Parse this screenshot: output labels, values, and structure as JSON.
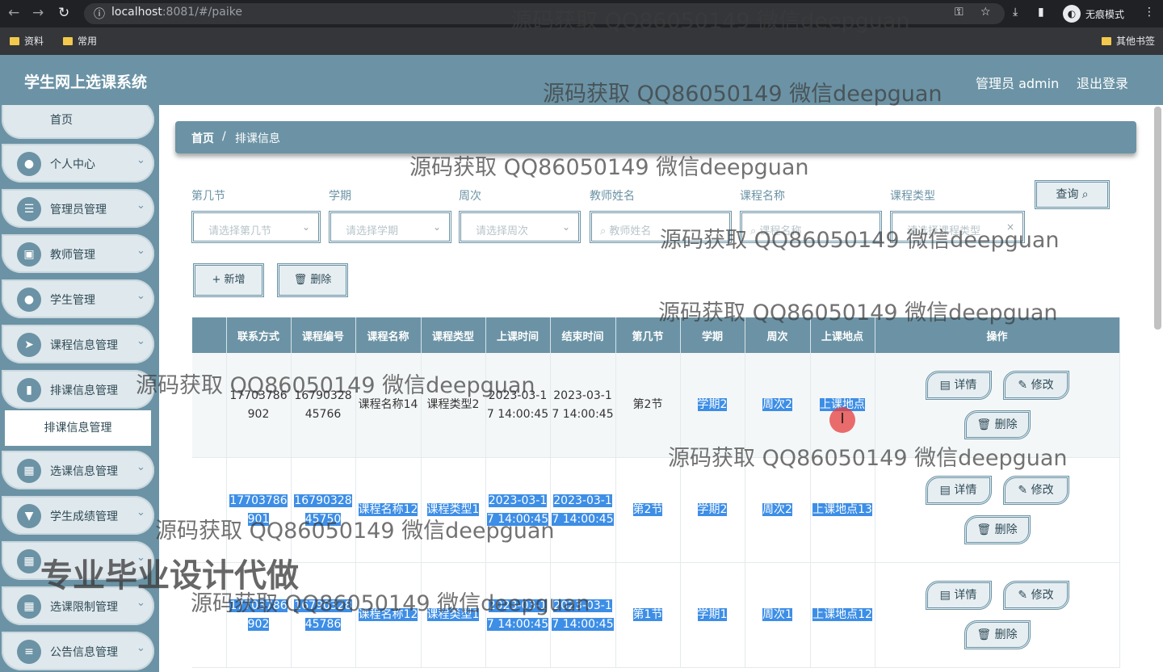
{
  "browser": {
    "url_host": "localhost",
    "url_rest": ":8081/#/paike",
    "incognito_label": "无痕模式",
    "bookmarks": [
      "资料",
      "常用"
    ],
    "other_bookmarks": "其他书签"
  },
  "header": {
    "title": "学生网上选课系统",
    "admin": "管理员 admin",
    "logout": "退出登录"
  },
  "sidebar": {
    "home": "首页",
    "items": [
      "个人中心",
      "管理员管理",
      "教师管理",
      "学生管理",
      "课程信息管理",
      "排课信息管理",
      "选课信息管理",
      "学生成绩管理",
      "",
      "选课限制管理",
      "公告信息管理"
    ],
    "icons": [
      "user-icon",
      "list-icon",
      "briefcase-icon",
      "user-icon",
      "send-icon",
      "bar-chart-icon",
      "grid-icon",
      "stamp-icon",
      "grid-icon",
      "grid-icon",
      "sliders-icon"
    ],
    "active_sub": "排课信息管理"
  },
  "breadcrumb": {
    "home": "首页",
    "sep": "/",
    "current": "排课信息"
  },
  "filters": [
    {
      "label": "第几节",
      "placeholder": "请选择第几节"
    },
    {
      "label": "学期",
      "placeholder": "请选择学期"
    },
    {
      "label": "周次",
      "placeholder": "请选择周次"
    },
    {
      "label": "教师姓名",
      "placeholder": "教师姓名"
    },
    {
      "label": "课程名称",
      "placeholder": "课程名称"
    },
    {
      "label": "课程类型",
      "placeholder": "请选择课程类型"
    }
  ],
  "buttons": {
    "query": "查询",
    "add": "+ 新增",
    "delete": "删除",
    "detail": "详情",
    "edit": "修改",
    "row_delete": "删除"
  },
  "table": {
    "columns": [
      "",
      "联系方式",
      "课程编号",
      "课程名称",
      "课程类型",
      "上课时间",
      "结束时间",
      "第几节",
      "学期",
      "周次",
      "上课地点",
      "操作"
    ],
    "rows": [
      [
        "",
        "17703786902",
        "1679032845766",
        "课程名称14",
        "课程类型2",
        "2023-03-17 14:00:45",
        "2023-03-17 14:00:45",
        "第2节",
        "学期2",
        "周次2",
        "上课地点"
      ],
      [
        "",
        "17703786901",
        "1679032845750",
        "课程名称12",
        "课程类型1",
        "2023-03-17 14:00:45",
        "2023-03-17 14:00:45",
        "第2节",
        "学期2",
        "周次2",
        "上课地点13"
      ],
      [
        "",
        "17703786902",
        "1679032845786",
        "课程名称12",
        "课程类型1",
        "2023-03-17 14:00:45",
        "2023-03-17 14:00:45",
        "第1节",
        "学期1",
        "周次1",
        "上课地点12"
      ]
    ]
  },
  "watermarks": [
    "源码获取 QQ86050149 微信deepguan"
  ],
  "big_watermark": "专业毕业设计代做"
}
